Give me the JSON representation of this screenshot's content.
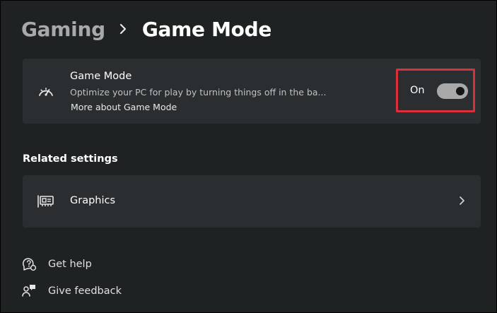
{
  "breadcrumb": {
    "parent": "Gaming",
    "current": "Game Mode"
  },
  "game_mode": {
    "title": "Game Mode",
    "description": "Optimize your PC for play by turning things off in the ba...",
    "link": "More about Game Mode",
    "toggle_state_label": "On",
    "toggle_on": true,
    "highlight_color": "#d9303a",
    "icon": "speedometer-icon"
  },
  "related": {
    "heading": "Related settings",
    "items": [
      {
        "label": "Graphics",
        "icon": "graphics-card-icon"
      }
    ]
  },
  "footer_links": [
    {
      "label": "Get help",
      "icon": "help-icon"
    },
    {
      "label": "Give feedback",
      "icon": "feedback-icon"
    }
  ]
}
